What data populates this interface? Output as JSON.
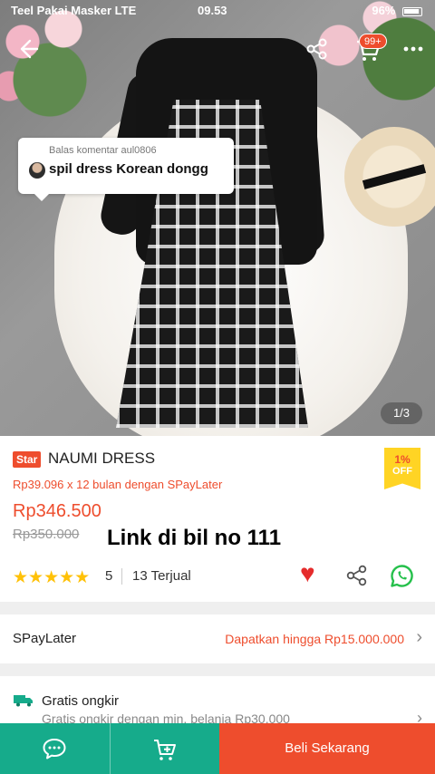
{
  "status_bar": {
    "carrier": "Teel Pakai Masker  LTE",
    "time": "09.53",
    "battery": "96%"
  },
  "top_nav": {
    "cart_badge": "99+"
  },
  "comment_bubble": {
    "reply_label": "Balas komentar aul0806",
    "text": "spil dress Korean dongg"
  },
  "gallery": {
    "counter": "1/3"
  },
  "product": {
    "badge": "Star",
    "title": "NAUMI DRESS",
    "discount_pct": "1%",
    "discount_off": "OFF",
    "installment": "Rp39.096 x 12 bulan dengan SPayLater",
    "price": "Rp346.500",
    "old_price": "Rp350.000",
    "overlay_note": "Link di bil no 111",
    "stars": "★★★★★",
    "rating": "5",
    "sold": "13 Terjual"
  },
  "spaylater": {
    "label": "SPayLater",
    "promo": "Dapatkan hingga Rp15.000.000"
  },
  "shipping": {
    "label": "Gratis ongkir",
    "subtitle": "Gratis ongkir dengan min. belanja Rp30.000"
  },
  "bottom_bar": {
    "buy_label": "Beli Sekarang"
  },
  "colors": {
    "brand": "#ee4d2d",
    "bottom_green": "#16ab8b",
    "star": "#ffc107"
  }
}
